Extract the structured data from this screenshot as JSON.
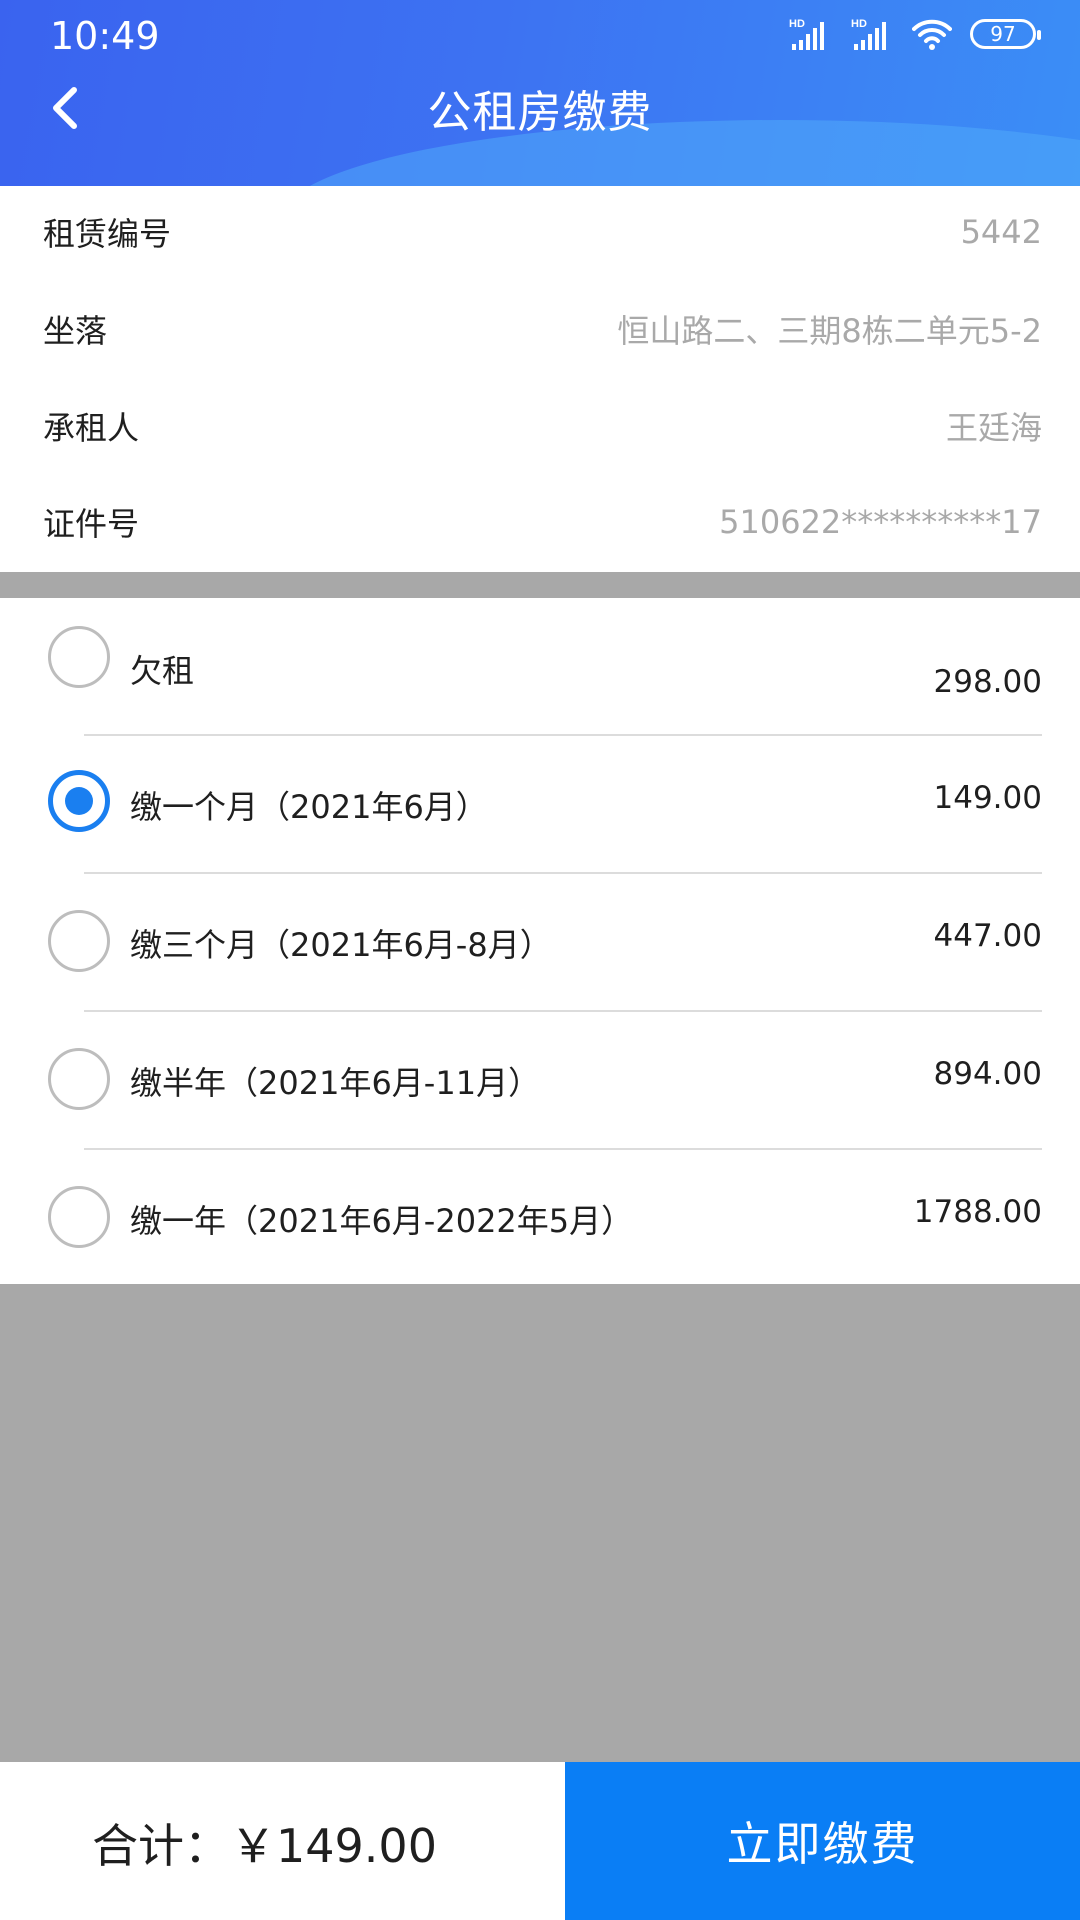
{
  "status_bar": {
    "time": "10:49",
    "signal_label": "HD",
    "battery": "97"
  },
  "header": {
    "title": "公租房缴费",
    "back_icon": "chevron-left-icon"
  },
  "info": {
    "rows": [
      {
        "label": "租赁编号",
        "value": "5442"
      },
      {
        "label": "坐落",
        "value": "恒山路二、三期8栋二单元5-2"
      },
      {
        "label": "承租人",
        "value": "王廷海"
      },
      {
        "label": "证件号",
        "value": "510622**********17"
      }
    ]
  },
  "options": [
    {
      "label": "欠租",
      "amount": "298.00",
      "selected": false
    },
    {
      "label": "缴一个月（2021年6月）",
      "amount": "149.00",
      "selected": true
    },
    {
      "label": "缴三个月（2021年6月-8月）",
      "amount": "447.00",
      "selected": false
    },
    {
      "label": "缴半年（2021年6月-11月）",
      "amount": "894.00",
      "selected": false
    },
    {
      "label": "缴一年（2021年6月-2022年5月）",
      "amount": "1788.00",
      "selected": false
    }
  ],
  "footer": {
    "total_label": "合计：",
    "total_amount": "￥149.00",
    "pay_button": "立即缴费"
  },
  "colors": {
    "accent": "#0a7ef5",
    "header_start": "#3a63ef",
    "header_end": "#3b8ef6",
    "muted_text": "#a9a9a9",
    "backdrop": "#a8a8a8"
  }
}
